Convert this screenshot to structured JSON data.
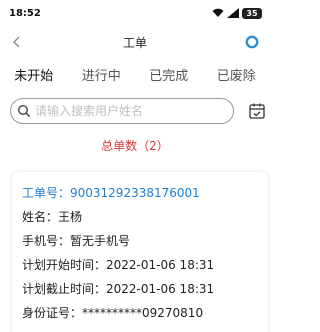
{
  "status_bar": {
    "time": "18:52",
    "battery": "35"
  },
  "nav": {
    "title": "工单"
  },
  "tabs": [
    "未开始",
    "进行中",
    "已完成",
    "已废除"
  ],
  "search": {
    "placeholder": "请输入搜索用户姓名"
  },
  "summary": {
    "total_label": "总单数（2）"
  },
  "card": {
    "order_no": "工单号：90031292338176001",
    "name": "姓名：王杨",
    "phone": "手机号：暂无手机号",
    "plan_start": "计划开始时间：2022-01-06 18:31",
    "plan_end": "计划截止时间：2022-01-06 18:31",
    "id_card": "身份证号：**********09270810"
  },
  "colors": {
    "accent": "#1d7fd1",
    "total": "#d83a3a",
    "action_icon": "#2a8fd8"
  },
  "icons": [
    "wifi-icon",
    "signal-icon",
    "back-icon",
    "circle-icon",
    "search-icon",
    "calendar-icon"
  ]
}
